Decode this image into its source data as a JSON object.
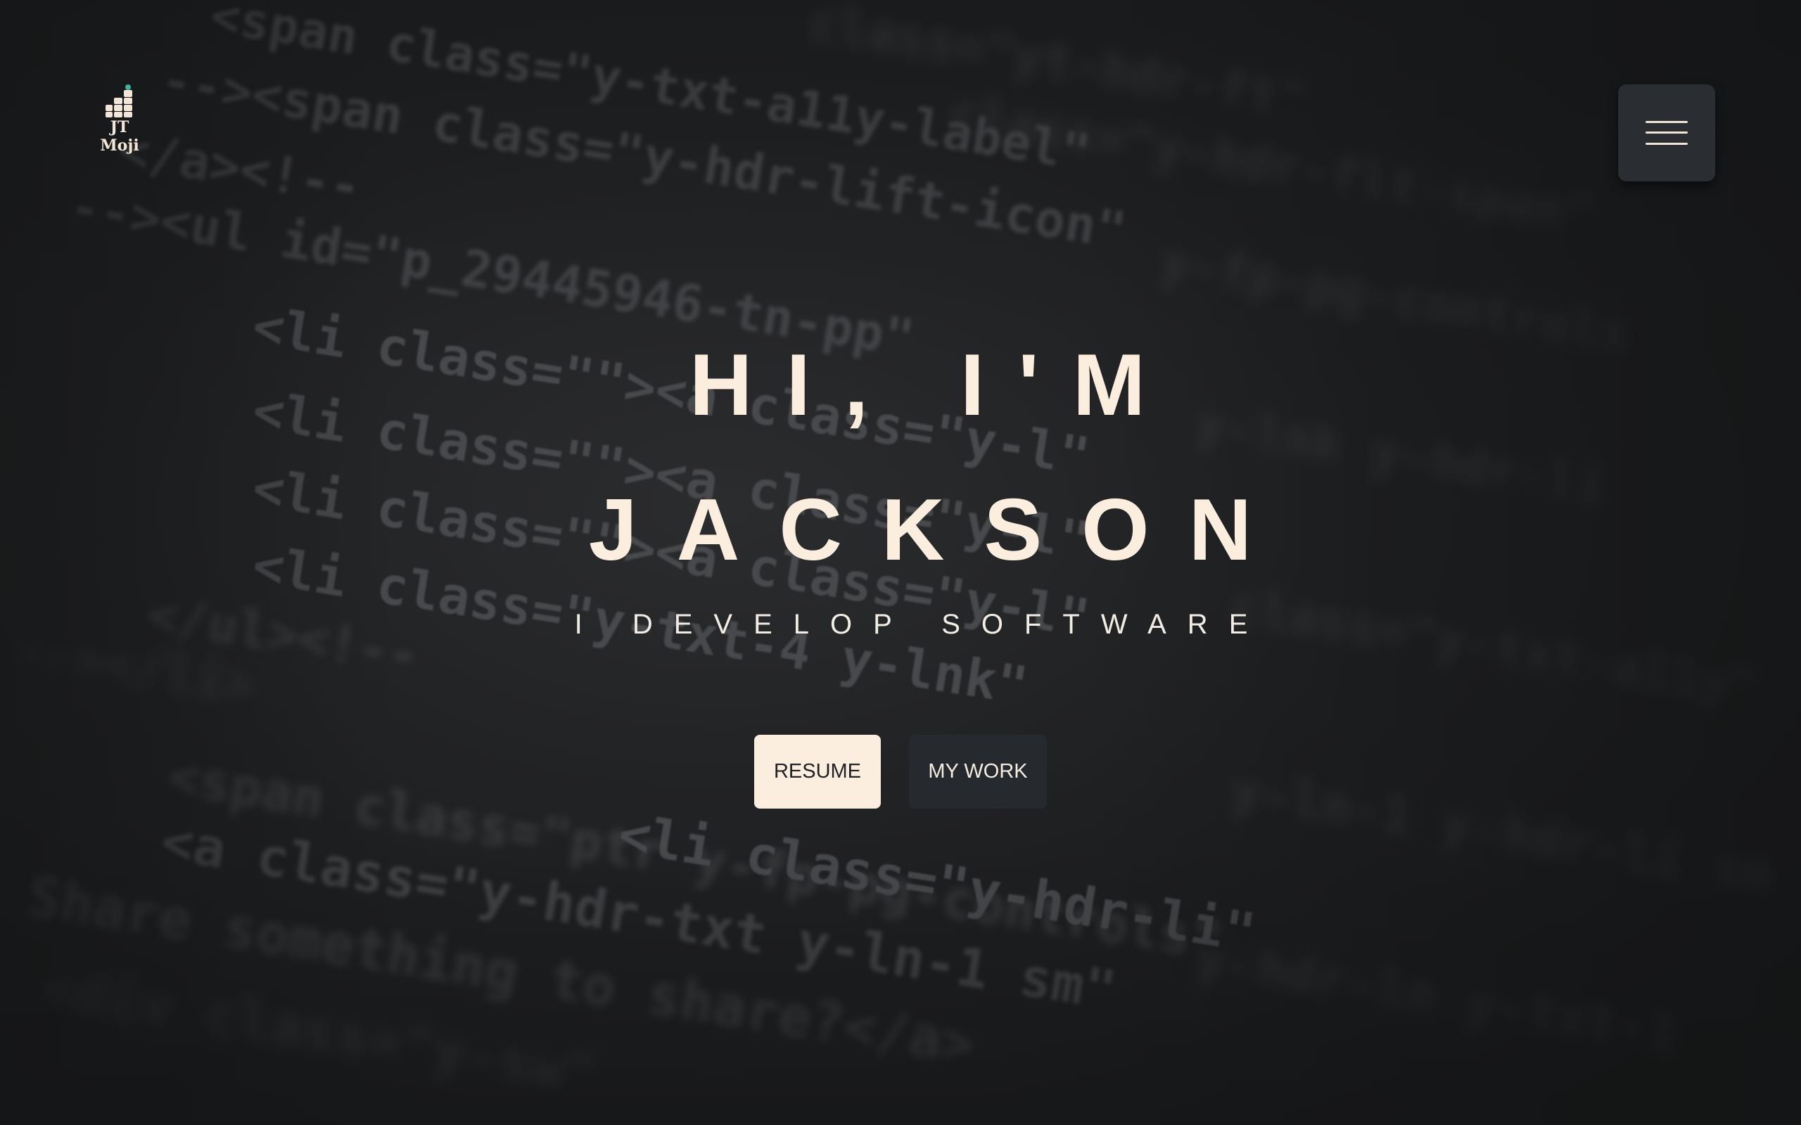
{
  "hero": {
    "greeting": "HI, I'M",
    "name": "JACKSON",
    "tagline": "I DEVELOP SOFTWARE"
  },
  "logo": {
    "line1": "JT",
    "line2": "Moji",
    "icon": "building-blocks-icon"
  },
  "menu": {
    "icon": "hamburger-menu-icon"
  },
  "buttons": {
    "resume": "RESUME",
    "work": "MY WORK"
  },
  "colors": {
    "background": "#1a1b1d",
    "text_primary": "#fbeedf",
    "button_light": "#fbeedf",
    "button_dark": "#262a2f",
    "menu_bg": "#2a2e33",
    "logo_accent": "#3db39a"
  }
}
